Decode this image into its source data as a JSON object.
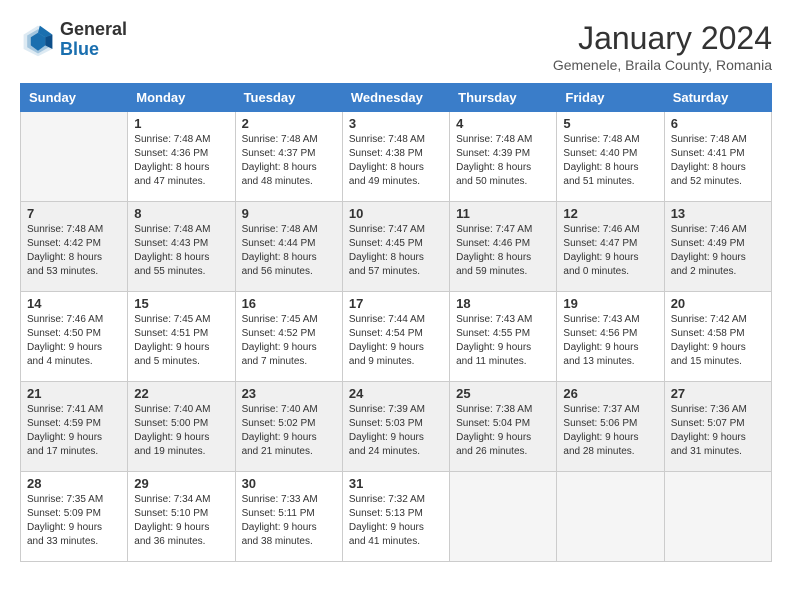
{
  "header": {
    "logo_general": "General",
    "logo_blue": "Blue",
    "title": "January 2024",
    "subtitle": "Gemenele, Braila County, Romania"
  },
  "days_of_week": [
    "Sunday",
    "Monday",
    "Tuesday",
    "Wednesday",
    "Thursday",
    "Friday",
    "Saturday"
  ],
  "weeks": [
    [
      {
        "day": "",
        "empty": true
      },
      {
        "day": "1",
        "sunrise": "Sunrise: 7:48 AM",
        "sunset": "Sunset: 4:36 PM",
        "daylight": "Daylight: 8 hours and 47 minutes."
      },
      {
        "day": "2",
        "sunrise": "Sunrise: 7:48 AM",
        "sunset": "Sunset: 4:37 PM",
        "daylight": "Daylight: 8 hours and 48 minutes."
      },
      {
        "day": "3",
        "sunrise": "Sunrise: 7:48 AM",
        "sunset": "Sunset: 4:38 PM",
        "daylight": "Daylight: 8 hours and 49 minutes."
      },
      {
        "day": "4",
        "sunrise": "Sunrise: 7:48 AM",
        "sunset": "Sunset: 4:39 PM",
        "daylight": "Daylight: 8 hours and 50 minutes."
      },
      {
        "day": "5",
        "sunrise": "Sunrise: 7:48 AM",
        "sunset": "Sunset: 4:40 PM",
        "daylight": "Daylight: 8 hours and 51 minutes."
      },
      {
        "day": "6",
        "sunrise": "Sunrise: 7:48 AM",
        "sunset": "Sunset: 4:41 PM",
        "daylight": "Daylight: 8 hours and 52 minutes."
      }
    ],
    [
      {
        "day": "7",
        "sunrise": "Sunrise: 7:48 AM",
        "sunset": "Sunset: 4:42 PM",
        "daylight": "Daylight: 8 hours and 53 minutes.",
        "shaded": true
      },
      {
        "day": "8",
        "sunrise": "Sunrise: 7:48 AM",
        "sunset": "Sunset: 4:43 PM",
        "daylight": "Daylight: 8 hours and 55 minutes.",
        "shaded": true
      },
      {
        "day": "9",
        "sunrise": "Sunrise: 7:48 AM",
        "sunset": "Sunset: 4:44 PM",
        "daylight": "Daylight: 8 hours and 56 minutes.",
        "shaded": true
      },
      {
        "day": "10",
        "sunrise": "Sunrise: 7:47 AM",
        "sunset": "Sunset: 4:45 PM",
        "daylight": "Daylight: 8 hours and 57 minutes.",
        "shaded": true
      },
      {
        "day": "11",
        "sunrise": "Sunrise: 7:47 AM",
        "sunset": "Sunset: 4:46 PM",
        "daylight": "Daylight: 8 hours and 59 minutes.",
        "shaded": true
      },
      {
        "day": "12",
        "sunrise": "Sunrise: 7:46 AM",
        "sunset": "Sunset: 4:47 PM",
        "daylight": "Daylight: 9 hours and 0 minutes.",
        "shaded": true
      },
      {
        "day": "13",
        "sunrise": "Sunrise: 7:46 AM",
        "sunset": "Sunset: 4:49 PM",
        "daylight": "Daylight: 9 hours and 2 minutes.",
        "shaded": true
      }
    ],
    [
      {
        "day": "14",
        "sunrise": "Sunrise: 7:46 AM",
        "sunset": "Sunset: 4:50 PM",
        "daylight": "Daylight: 9 hours and 4 minutes."
      },
      {
        "day": "15",
        "sunrise": "Sunrise: 7:45 AM",
        "sunset": "Sunset: 4:51 PM",
        "daylight": "Daylight: 9 hours and 5 minutes."
      },
      {
        "day": "16",
        "sunrise": "Sunrise: 7:45 AM",
        "sunset": "Sunset: 4:52 PM",
        "daylight": "Daylight: 9 hours and 7 minutes."
      },
      {
        "day": "17",
        "sunrise": "Sunrise: 7:44 AM",
        "sunset": "Sunset: 4:54 PM",
        "daylight": "Daylight: 9 hours and 9 minutes."
      },
      {
        "day": "18",
        "sunrise": "Sunrise: 7:43 AM",
        "sunset": "Sunset: 4:55 PM",
        "daylight": "Daylight: 9 hours and 11 minutes."
      },
      {
        "day": "19",
        "sunrise": "Sunrise: 7:43 AM",
        "sunset": "Sunset: 4:56 PM",
        "daylight": "Daylight: 9 hours and 13 minutes."
      },
      {
        "day": "20",
        "sunrise": "Sunrise: 7:42 AM",
        "sunset": "Sunset: 4:58 PM",
        "daylight": "Daylight: 9 hours and 15 minutes."
      }
    ],
    [
      {
        "day": "21",
        "sunrise": "Sunrise: 7:41 AM",
        "sunset": "Sunset: 4:59 PM",
        "daylight": "Daylight: 9 hours and 17 minutes.",
        "shaded": true
      },
      {
        "day": "22",
        "sunrise": "Sunrise: 7:40 AM",
        "sunset": "Sunset: 5:00 PM",
        "daylight": "Daylight: 9 hours and 19 minutes.",
        "shaded": true
      },
      {
        "day": "23",
        "sunrise": "Sunrise: 7:40 AM",
        "sunset": "Sunset: 5:02 PM",
        "daylight": "Daylight: 9 hours and 21 minutes.",
        "shaded": true
      },
      {
        "day": "24",
        "sunrise": "Sunrise: 7:39 AM",
        "sunset": "Sunset: 5:03 PM",
        "daylight": "Daylight: 9 hours and 24 minutes.",
        "shaded": true
      },
      {
        "day": "25",
        "sunrise": "Sunrise: 7:38 AM",
        "sunset": "Sunset: 5:04 PM",
        "daylight": "Daylight: 9 hours and 26 minutes.",
        "shaded": true
      },
      {
        "day": "26",
        "sunrise": "Sunrise: 7:37 AM",
        "sunset": "Sunset: 5:06 PM",
        "daylight": "Daylight: 9 hours and 28 minutes.",
        "shaded": true
      },
      {
        "day": "27",
        "sunrise": "Sunrise: 7:36 AM",
        "sunset": "Sunset: 5:07 PM",
        "daylight": "Daylight: 9 hours and 31 minutes.",
        "shaded": true
      }
    ],
    [
      {
        "day": "28",
        "sunrise": "Sunrise: 7:35 AM",
        "sunset": "Sunset: 5:09 PM",
        "daylight": "Daylight: 9 hours and 33 minutes."
      },
      {
        "day": "29",
        "sunrise": "Sunrise: 7:34 AM",
        "sunset": "Sunset: 5:10 PM",
        "daylight": "Daylight: 9 hours and 36 minutes."
      },
      {
        "day": "30",
        "sunrise": "Sunrise: 7:33 AM",
        "sunset": "Sunset: 5:11 PM",
        "daylight": "Daylight: 9 hours and 38 minutes."
      },
      {
        "day": "31",
        "sunrise": "Sunrise: 7:32 AM",
        "sunset": "Sunset: 5:13 PM",
        "daylight": "Daylight: 9 hours and 41 minutes."
      },
      {
        "day": "",
        "empty": true
      },
      {
        "day": "",
        "empty": true
      },
      {
        "day": "",
        "empty": true
      }
    ]
  ]
}
